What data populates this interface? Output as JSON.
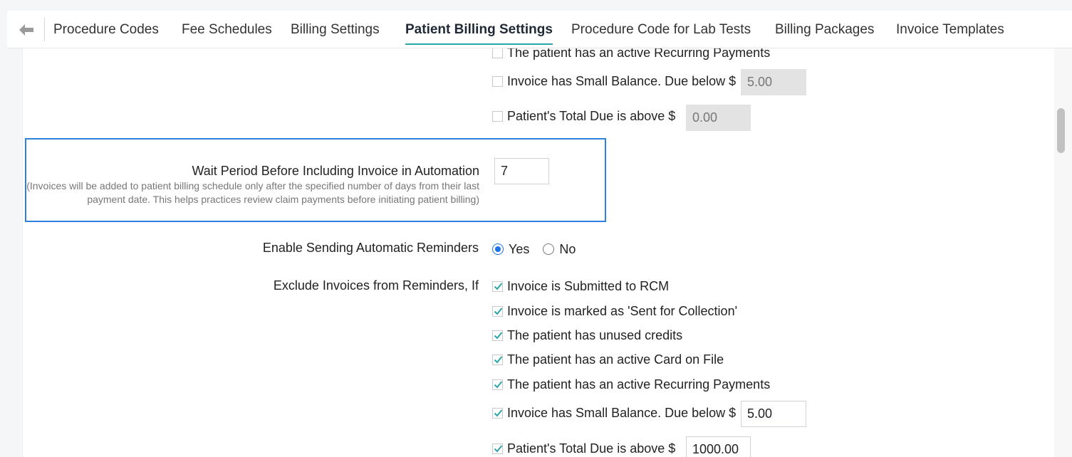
{
  "tabs": [
    {
      "label": "Procedure Codes",
      "active": false
    },
    {
      "label": "Fee Schedules",
      "active": false
    },
    {
      "label": "Billing Settings",
      "active": false
    },
    {
      "label": "Patient Billing Settings",
      "active": true
    },
    {
      "label": "Procedure Code for Lab Tests",
      "active": false
    },
    {
      "label": "Billing Packages",
      "active": false
    },
    {
      "label": "Invoice Templates",
      "active": false
    }
  ],
  "automation_exclusions": {
    "recurring_label": "The patient has an active Recurring Payments",
    "recurring_checked": false,
    "small_balance_label": "Invoice has Small Balance. Due below $",
    "small_balance_checked": false,
    "small_balance_value": "5.00",
    "total_due_label": "Patient's Total Due is above $",
    "total_due_checked": false,
    "total_due_value": "0.00"
  },
  "wait_period": {
    "label": "Wait Period Before Including Invoice in Automation",
    "help": "(Invoices will be added to patient billing schedule only after the specified number of days from their last payment date. This helps practices review claim payments before initiating patient billing)",
    "value": "7"
  },
  "reminders": {
    "label": "Enable Sending Automatic Reminders",
    "yes_label": "Yes",
    "no_label": "No",
    "selected": "Yes"
  },
  "reminder_exclusions": {
    "label": "Exclude Invoices from Reminders, If",
    "options": [
      {
        "label": "Invoice is Submitted to RCM",
        "checked": true
      },
      {
        "label": "Invoice is marked as 'Sent for Collection'",
        "checked": true
      },
      {
        "label": "The patient has unused credits",
        "checked": true
      },
      {
        "label": "The patient has an active Card on File",
        "checked": true
      },
      {
        "label": "The patient has an active Recurring Payments",
        "checked": true
      }
    ],
    "small_balance_label": "Invoice has Small Balance. Due below $",
    "small_balance_checked": true,
    "small_balance_value": "5.00",
    "total_due_label": "Patient's Total Due is above $",
    "total_due_checked": true,
    "total_due_value": "1000.00"
  },
  "colors": {
    "accent": "#2da5a9",
    "highlight_border": "#2f7fdd",
    "radio_selected": "#1a73e8"
  }
}
